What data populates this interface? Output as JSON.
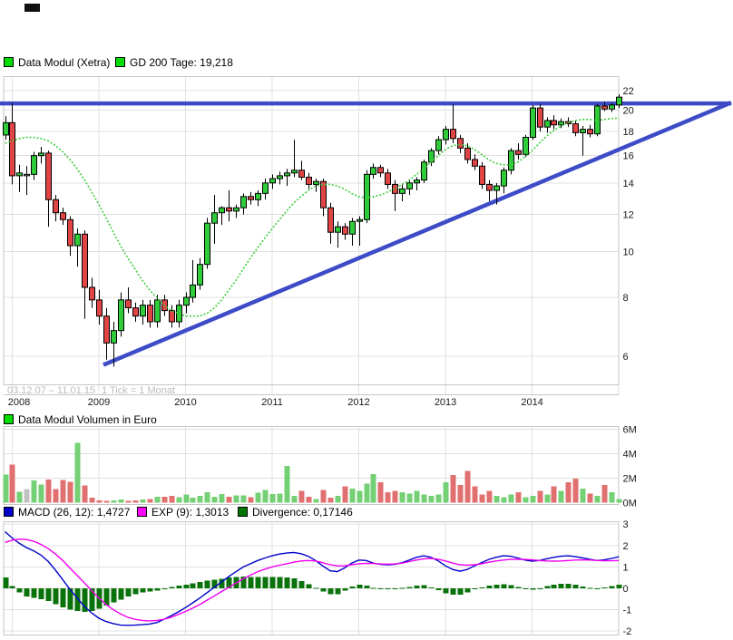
{
  "colors": {
    "candle_up": "#2fcb38",
    "candle_down": "#e14444",
    "candle_neutral": "#c2c2c2",
    "volume_up": "#74d074",
    "volume_down": "#e17070",
    "volume_neutral": "#c2c2c2",
    "gd200_line": "#3ecc3e",
    "trendline_blue": "#3d4bc7",
    "macd_line": "#0000c8",
    "exp_line": "#f000f0",
    "divergence_bar": "#0a720a",
    "legend_green": "#00dd00",
    "legend_blue": "#0000cc",
    "legend_magenta": "#ff00ff",
    "legend_darkgreen": "#007700",
    "grid": "#e0e0e0",
    "frame": "#c6c6c6",
    "footer_text": "#bcbcbc"
  },
  "price_panel": {
    "legend": [
      {
        "swatch": "#00dd00",
        "label": "Data Modul (Xetra)"
      },
      {
        "swatch": "#00dd00",
        "label": "GD 200 Tage: 19,218"
      }
    ],
    "footer": {
      "range": "03.12.07 – 11.01.15",
      "tick": "1 Tick = 1 Monat"
    },
    "y_ticks": [
      "22",
      "20",
      "18",
      "16",
      "14",
      "12",
      "10",
      "8",
      "6"
    ],
    "x_ticks": [
      "2008",
      "2009",
      "2010",
      "2011",
      "2012",
      "2013",
      "2014"
    ]
  },
  "volume_panel": {
    "legend": [
      {
        "swatch": "#00dd00",
        "label": "Data Modul Volumen in Euro"
      }
    ],
    "y_ticks": [
      "6M",
      "4M",
      "2M",
      "0M"
    ]
  },
  "macd_panel": {
    "legend": [
      {
        "swatch": "#0000cc",
        "label": "MACD (26, 12): 1,4727"
      },
      {
        "swatch": "#ff00ff",
        "label": "EXP (9): 1,3013"
      },
      {
        "swatch": "#007700",
        "label": "Divergence: 0,17146"
      }
    ],
    "y_ticks": [
      "3",
      "2",
      "1",
      "0",
      "-1",
      "-2"
    ]
  },
  "chart_data": [
    {
      "type": "candlestick",
      "title": "Data Modul (Xetra)",
      "overlay": "GD 200 Tage",
      "gd200_last_value": "19,218",
      "x_start": "2007-12",
      "x_end": "2015-01",
      "tick_unit": "1 Monat",
      "scale": "logarithmic",
      "ylim": [
        5.5,
        23.5
      ],
      "y_ticks": [
        22,
        20,
        18,
        16,
        14,
        12,
        10,
        8,
        6
      ],
      "x_tick_years": [
        "2008",
        "2009",
        "2010",
        "2011",
        "2012",
        "2013",
        "2014"
      ],
      "january_indices": [
        1,
        13,
        25,
        37,
        49,
        61,
        73,
        85
      ],
      "doji_gray_indices": [
        3
      ],
      "candles": [
        [
          17.7,
          19.4,
          17.3,
          18.8
        ],
        [
          18.8,
          20.7,
          13.9,
          14.5
        ],
        [
          14.5,
          15.3,
          13.4,
          14.7
        ],
        [
          14.6,
          15.2,
          13.2,
          14.6
        ],
        [
          14.6,
          16.3,
          14.2,
          16.0
        ],
        [
          16.0,
          16.7,
          15.4,
          16.2
        ],
        [
          16.2,
          16.4,
          11.3,
          12.9
        ],
        [
          12.9,
          13.2,
          11.6,
          12.1
        ],
        [
          12.1,
          12.4,
          11.4,
          11.7
        ],
        [
          11.7,
          11.9,
          9.8,
          10.3
        ],
        [
          10.3,
          11.2,
          9.3,
          10.9
        ],
        [
          10.9,
          11.1,
          7.2,
          8.4
        ],
        [
          8.4,
          8.8,
          7.6,
          7.9
        ],
        [
          7.9,
          8.3,
          7.0,
          7.3
        ],
        [
          7.3,
          7.6,
          5.9,
          6.4
        ],
        [
          6.4,
          7.1,
          5.7,
          6.8
        ],
        [
          6.8,
          8.2,
          6.6,
          7.9
        ],
        [
          7.9,
          8.4,
          7.4,
          7.6
        ],
        [
          7.6,
          7.8,
          7.1,
          7.3
        ],
        [
          7.3,
          7.9,
          7.0,
          7.7
        ],
        [
          7.7,
          7.9,
          6.9,
          7.1
        ],
        [
          7.1,
          8.1,
          6.9,
          7.9
        ],
        [
          7.9,
          8.1,
          7.3,
          7.5
        ],
        [
          7.5,
          7.7,
          6.9,
          7.1
        ],
        [
          7.1,
          7.9,
          6.9,
          7.7
        ],
        [
          7.7,
          8.2,
          7.4,
          8.0
        ],
        [
          8.0,
          9.6,
          7.8,
          8.5
        ],
        [
          8.5,
          9.7,
          8.3,
          9.4
        ],
        [
          9.4,
          11.8,
          9.2,
          11.5
        ],
        [
          11.5,
          13.2,
          10.4,
          12.1
        ],
        [
          12.1,
          12.5,
          11.4,
          12.4
        ],
        [
          12.4,
          13.5,
          11.6,
          12.2
        ],
        [
          12.2,
          12.6,
          11.8,
          12.4
        ],
        [
          12.4,
          13.3,
          12.0,
          13.1
        ],
        [
          13.1,
          13.4,
          12.6,
          12.9
        ],
        [
          12.9,
          13.5,
          12.5,
          13.3
        ],
        [
          13.3,
          14.3,
          12.9,
          14.0
        ],
        [
          14.0,
          14.6,
          13.6,
          14.3
        ],
        [
          14.3,
          14.8,
          13.9,
          14.5
        ],
        [
          14.5,
          15.0,
          13.8,
          14.7
        ],
        [
          14.7,
          17.3,
          14.4,
          14.9
        ],
        [
          14.9,
          15.6,
          14.2,
          14.4
        ],
        [
          14.4,
          14.7,
          13.6,
          13.9
        ],
        [
          13.9,
          14.3,
          13.4,
          14.1
        ],
        [
          14.1,
          14.3,
          11.9,
          12.4
        ],
        [
          12.4,
          12.7,
          10.4,
          11.0
        ],
        [
          11.0,
          11.6,
          10.2,
          11.3
        ],
        [
          11.3,
          11.5,
          10.6,
          10.9
        ],
        [
          10.9,
          11.8,
          10.3,
          11.6
        ],
        [
          11.6,
          11.9,
          10.3,
          11.7
        ],
        [
          11.7,
          14.9,
          11.5,
          14.6
        ],
        [
          14.6,
          15.4,
          14.3,
          15.1
        ],
        [
          15.1,
          15.3,
          14.4,
          14.7
        ],
        [
          14.7,
          15.0,
          13.6,
          13.9
        ],
        [
          13.9,
          14.2,
          12.2,
          13.3
        ],
        [
          13.3,
          13.9,
          12.8,
          13.6
        ],
        [
          13.6,
          14.2,
          13.2,
          14.0
        ],
        [
          14.0,
          14.4,
          13.5,
          14.2
        ],
        [
          14.2,
          15.7,
          14.0,
          15.5
        ],
        [
          15.5,
          16.6,
          15.2,
          16.4
        ],
        [
          16.4,
          17.6,
          16.1,
          17.3
        ],
        [
          17.3,
          18.5,
          16.9,
          18.2
        ],
        [
          18.2,
          20.6,
          17.0,
          17.4
        ],
        [
          17.4,
          17.7,
          16.2,
          16.6
        ],
        [
          16.6,
          17.0,
          15.4,
          15.7
        ],
        [
          15.7,
          16.1,
          14.9,
          15.2
        ],
        [
          15.2,
          15.5,
          13.6,
          13.9
        ],
        [
          13.9,
          14.2,
          12.8,
          13.5
        ],
        [
          13.5,
          14.0,
          12.6,
          13.8
        ],
        [
          13.8,
          15.1,
          13.3,
          14.9
        ],
        [
          14.9,
          16.6,
          14.6,
          16.4
        ],
        [
          16.4,
          17.0,
          15.7,
          16.1
        ],
        [
          16.1,
          17.7,
          15.9,
          17.5
        ],
        [
          17.5,
          20.5,
          17.3,
          20.2
        ],
        [
          20.2,
          20.6,
          18.0,
          18.4
        ],
        [
          18.4,
          19.3,
          17.9,
          19.0
        ],
        [
          19.0,
          19.5,
          18.2,
          18.6
        ],
        [
          18.6,
          19.2,
          18.3,
          18.9
        ],
        [
          18.9,
          19.3,
          18.4,
          18.7
        ],
        [
          18.7,
          19.0,
          17.6,
          17.9
        ],
        [
          17.9,
          18.5,
          16.0,
          18.2
        ],
        [
          18.2,
          18.6,
          17.5,
          17.8
        ],
        [
          17.8,
          20.6,
          17.6,
          20.4
        ],
        [
          20.4,
          20.8,
          19.9,
          20.1
        ],
        [
          20.1,
          20.7,
          19.8,
          20.5
        ],
        [
          20.5,
          21.6,
          20.2,
          21.3
        ]
      ],
      "gd200": [
        17.0,
        17.2,
        17.4,
        17.5,
        17.5,
        17.4,
        17.2,
        16.8,
        16.3,
        15.7,
        15.0,
        14.2,
        13.4,
        12.6,
        11.8,
        11.0,
        10.3,
        9.7,
        9.2,
        8.7,
        8.3,
        8.0,
        7.7,
        7.5,
        7.4,
        7.3,
        7.3,
        7.3,
        7.4,
        7.6,
        7.9,
        8.3,
        8.7,
        9.2,
        9.7,
        10.2,
        10.7,
        11.2,
        11.7,
        12.2,
        12.7,
        13.1,
        13.5,
        13.8,
        13.9,
        13.9,
        13.8,
        13.6,
        13.3,
        13.1,
        13.0,
        13.1,
        13.2,
        13.4,
        13.6,
        13.9,
        14.2,
        14.6,
        15.0,
        15.5,
        16.0,
        16.5,
        16.8,
        16.9,
        16.8,
        16.5,
        16.1,
        15.7,
        15.4,
        15.3,
        15.3,
        15.5,
        15.9,
        16.4,
        17.0,
        17.6,
        18.1,
        18.5,
        18.8,
        19.0,
        19.1,
        19.1,
        19.0,
        19.1,
        19.2,
        19.218
      ],
      "trendlines": [
        {
          "name": "resistance",
          "style": "horizontal",
          "value": 20.65
        },
        {
          "name": "support",
          "style": "ascending",
          "from_value": 5.75,
          "to_value": 20.65
        }
      ]
    },
    {
      "type": "bar",
      "title": "Data Modul Volumen in Euro",
      "unit": "M",
      "ylim": [
        0,
        6
      ],
      "y_ticks": [
        "6M",
        "4M",
        "2M",
        "0M"
      ],
      "color_rule": "green if monthly close >= open, red if down, gray if unchanged",
      "values": [
        2.3,
        3.1,
        0.9,
        1.1,
        1.8,
        1.5,
        1.9,
        1.1,
        1.85,
        1.7,
        4.9,
        1.4,
        0.4,
        0.2,
        0.15,
        0.2,
        0.25,
        0.15,
        0.2,
        0.25,
        0.3,
        0.5,
        0.5,
        0.55,
        0.45,
        0.65,
        0.4,
        0.55,
        0.85,
        0.5,
        0.7,
        0.5,
        0.6,
        0.6,
        0.45,
        0.8,
        1.05,
        0.7,
        0.75,
        3.0,
        0.55,
        0.95,
        0.5,
        0.3,
        1.05,
        0.4,
        0.55,
        1.35,
        1.15,
        0.95,
        1.55,
        2.35,
        1.65,
        0.85,
        0.95,
        0.85,
        0.75,
        0.95,
        0.65,
        0.55,
        0.65,
        1.65,
        2.25,
        1.45,
        2.6,
        1.35,
        0.65,
        0.95,
        0.55,
        0.45,
        0.65,
        0.85,
        0.45,
        0.55,
        0.95,
        0.65,
        1.35,
        0.95,
        1.65,
        1.95,
        1.15,
        0.75,
        0.55,
        1.45,
        0.85,
        0.3
      ]
    },
    {
      "type": "line+bar",
      "title": "MACD (26, 12) / EXP (9) / Divergence",
      "last_macd": "1,4727",
      "last_exp": "1,3013",
      "last_divergence": "0,17146",
      "ylim": [
        -2.3,
        3.2
      ],
      "y_ticks": [
        3,
        2,
        1,
        0,
        -1,
        -2
      ],
      "divergence_rule": "histogram of macd minus exp",
      "macd": [
        2.65,
        2.35,
        2.1,
        1.9,
        1.75,
        1.55,
        1.25,
        0.85,
        0.4,
        -0.05,
        -0.45,
        -0.85,
        -1.15,
        -1.4,
        -1.55,
        -1.65,
        -1.72,
        -1.73,
        -1.72,
        -1.7,
        -1.67,
        -1.6,
        -1.45,
        -1.28,
        -1.1,
        -0.9,
        -0.68,
        -0.45,
        -0.2,
        0.05,
        0.3,
        0.55,
        0.78,
        1.0,
        1.15,
        1.3,
        1.42,
        1.52,
        1.6,
        1.65,
        1.68,
        1.62,
        1.5,
        1.3,
        1.05,
        0.82,
        0.78,
        0.95,
        1.18,
        1.32,
        1.3,
        1.18,
        1.12,
        1.1,
        1.12,
        1.2,
        1.32,
        1.45,
        1.52,
        1.45,
        1.28,
        1.05,
        0.88,
        0.8,
        0.88,
        1.05,
        1.2,
        1.35,
        1.45,
        1.52,
        1.5,
        1.42,
        1.32,
        1.27,
        1.3,
        1.38,
        1.45,
        1.5,
        1.52,
        1.48,
        1.42,
        1.35,
        1.3,
        1.33,
        1.4,
        1.4727
      ],
      "exp": [
        2.15,
        2.25,
        2.3,
        2.28,
        2.2,
        2.05,
        1.85,
        1.6,
        1.3,
        0.95,
        0.6,
        0.25,
        -0.1,
        -0.45,
        -0.75,
        -1.0,
        -1.2,
        -1.35,
        -1.45,
        -1.5,
        -1.52,
        -1.5,
        -1.45,
        -1.35,
        -1.22,
        -1.08,
        -0.92,
        -0.75,
        -0.55,
        -0.35,
        -0.15,
        0.05,
        0.25,
        0.45,
        0.62,
        0.78,
        0.9,
        1.0,
        1.08,
        1.15,
        1.22,
        1.28,
        1.3,
        1.28,
        1.2,
        1.1,
        1.05,
        1.05,
        1.1,
        1.15,
        1.17,
        1.16,
        1.14,
        1.13,
        1.14,
        1.18,
        1.25,
        1.32,
        1.38,
        1.4,
        1.36,
        1.28,
        1.18,
        1.1,
        1.08,
        1.1,
        1.15,
        1.22,
        1.28,
        1.32,
        1.35,
        1.36,
        1.35,
        1.33,
        1.3,
        1.28,
        1.27,
        1.28,
        1.3,
        1.32,
        1.33,
        1.32,
        1.3,
        1.29,
        1.29,
        1.3013
      ]
    }
  ]
}
